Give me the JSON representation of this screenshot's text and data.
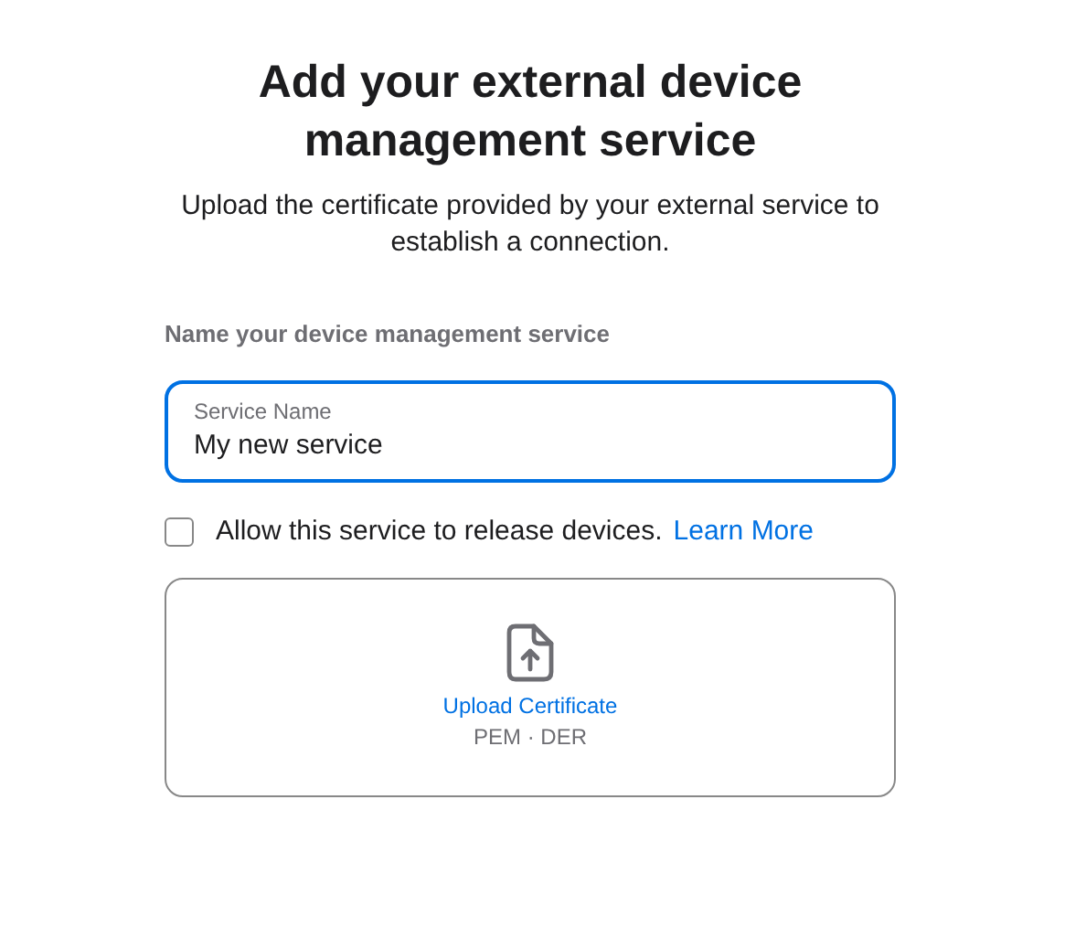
{
  "title": "Add your external device management service",
  "subtitle": "Upload the certificate provided by your external service to establish a connection.",
  "section_label": "Name your device management service",
  "service_name_field": {
    "label": "Service Name",
    "value": "My new service",
    "focused": true
  },
  "release_checkbox": {
    "label": "Allow this service to release devices.",
    "link": "Learn More",
    "checked": false
  },
  "upload": {
    "label": "Upload Certificate",
    "formats": "PEM · DER"
  }
}
